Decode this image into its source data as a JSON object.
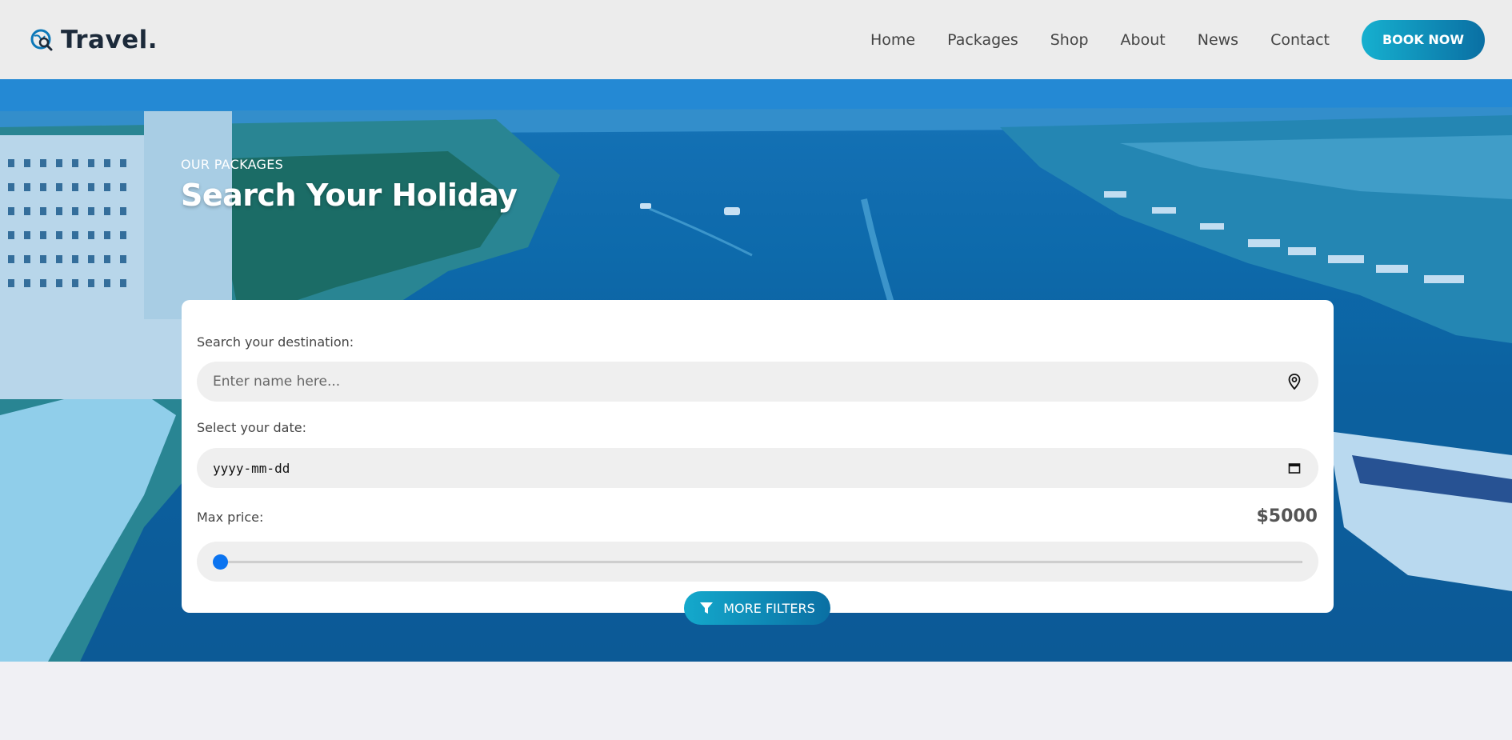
{
  "header": {
    "logo_text": "Travel.",
    "logo_icon": "globe-search-icon",
    "nav": [
      "Home",
      "Packages",
      "Shop",
      "About",
      "News",
      "Contact"
    ],
    "book_label": "BOOK NOW"
  },
  "hero": {
    "eyebrow": "OUR PACKAGES",
    "title": "Search Your Holiday"
  },
  "search": {
    "destination_label": "Search your destination:",
    "destination_placeholder": "Enter name here...",
    "destination_icon": "location-pin-icon",
    "date_label": "Select your date:",
    "date_placeholder": "yyyy-mm-dd",
    "date_icon": "calendar-icon",
    "price_label": "Max price:",
    "price_value": "$5000",
    "price_slider_fraction": 0.0,
    "more_filters_label": "MORE FILTERS",
    "filter_icon": "funnel-icon"
  },
  "colors": {
    "accent_start": "#16b0cf",
    "accent_end": "#0a6fa3",
    "slider_thumb": "#0b74f0"
  }
}
